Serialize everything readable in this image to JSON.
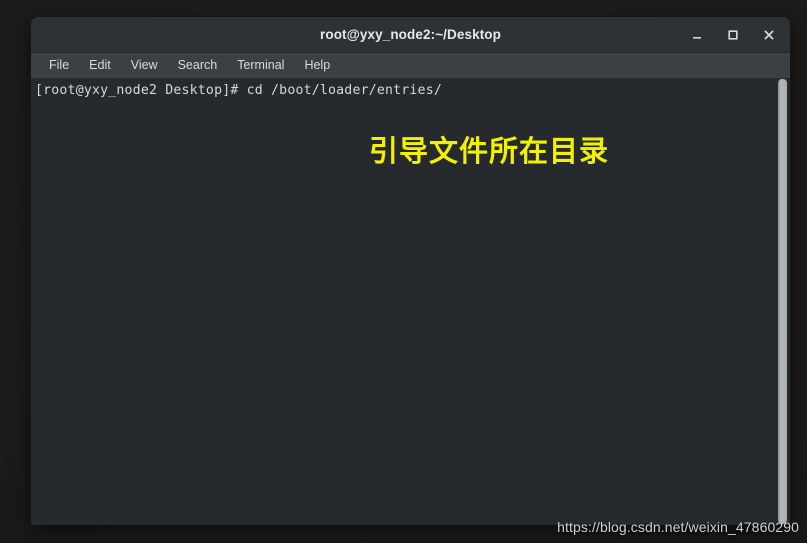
{
  "window": {
    "title": "root@yxy_node2:~/Desktop",
    "controls": {
      "minimize_label": "_",
      "maximize_label": "□",
      "close_label": "×"
    }
  },
  "menubar": {
    "items": [
      {
        "label": "File"
      },
      {
        "label": "Edit"
      },
      {
        "label": "View"
      },
      {
        "label": "Search"
      },
      {
        "label": "Terminal"
      },
      {
        "label": "Help"
      }
    ]
  },
  "terminal": {
    "prompt_line": "[root@yxy_node2 Desktop]# cd /boot/loader/entries/",
    "annotation": "引导文件所在目录",
    "annotation_color": "#f2f200",
    "background_color": "#26292d",
    "foreground_color": "#d6dacd"
  },
  "scrollbar": {
    "name": "vertical-scrollbar"
  },
  "watermark": {
    "text": "https://blog.csdn.net/weixin_47860290"
  }
}
